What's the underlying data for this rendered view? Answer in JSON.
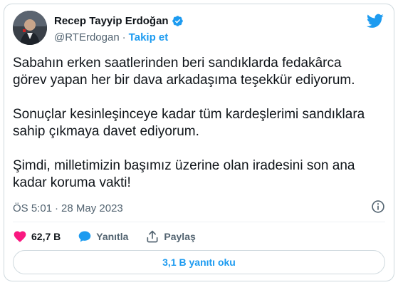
{
  "author": {
    "name": "Recep Tayyip Erdoğan",
    "handle": "@RTErdogan",
    "separator": "·",
    "follow_label": "Takip et"
  },
  "tweet": {
    "paragraphs": [
      "Sabahın erken saatlerinden beri sandıklarda fedakârca\ngörev yapan her bir dava arkadaşıma teşekkür ediyorum.",
      "Sonuçlar kesinleşinceye kadar tüm kardeşlerimi sandıklara\nsahip çıkmaya davet ediyorum.",
      "Şimdi, milletimizin başımız üzerine olan iradesini son ana\nkadar koruma vakti!"
    ],
    "time": "ÖS 5:01",
    "date": "28 May 2023",
    "meta_separator": "·"
  },
  "actions": {
    "like_count": "62,7 B",
    "reply_label": "Yanıtla",
    "share_label": "Paylaş",
    "read_replies_label": "3,1 B yanıtı oku"
  },
  "colors": {
    "accent": "#1d9bf0",
    "like": "#f91880",
    "text_primary": "#0f1419",
    "text_secondary": "#536471",
    "border": "#cfd9de"
  },
  "icons": [
    "verified-badge-icon",
    "twitter-bird-icon",
    "info-icon",
    "heart-icon",
    "speech-bubble-icon",
    "share-icon"
  ]
}
